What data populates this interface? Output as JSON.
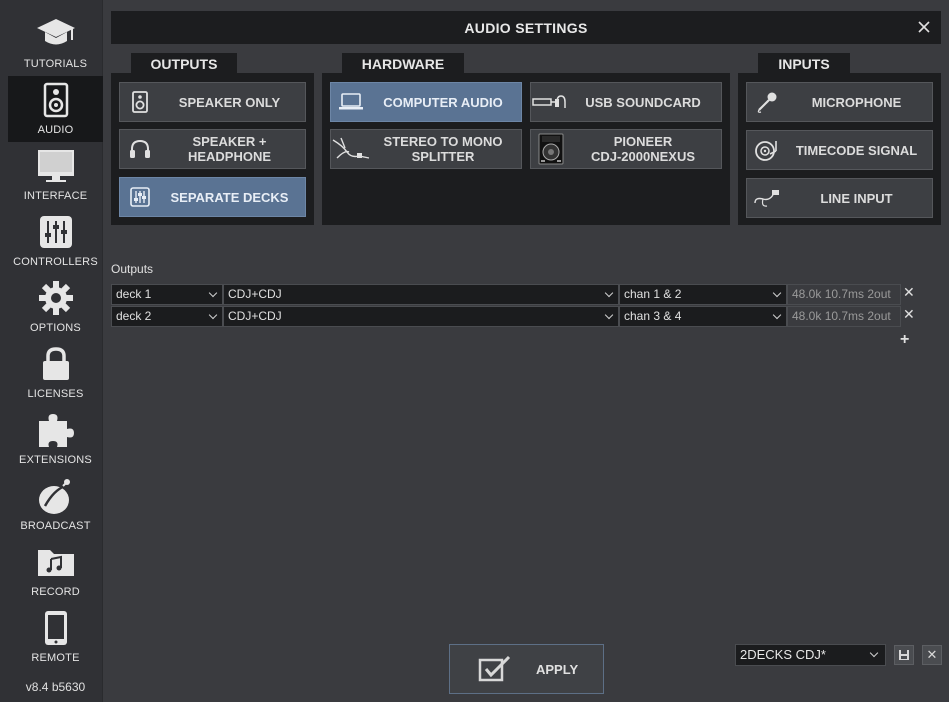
{
  "sidebar": {
    "items": [
      {
        "label": "TUTORIALS",
        "icon": "graduation-cap-icon"
      },
      {
        "label": "AUDIO",
        "icon": "speaker-icon",
        "active": true
      },
      {
        "label": "INTERFACE",
        "icon": "monitor-icon"
      },
      {
        "label": "CONTROLLERS",
        "icon": "sliders-icon"
      },
      {
        "label": "OPTIONS",
        "icon": "gear-icon"
      },
      {
        "label": "LICENSES",
        "icon": "lock-icon"
      },
      {
        "label": "EXTENSIONS",
        "icon": "puzzle-icon"
      },
      {
        "label": "BROADCAST",
        "icon": "satellite-dish-icon"
      },
      {
        "label": "RECORD",
        "icon": "music-folder-icon"
      },
      {
        "label": "REMOTE",
        "icon": "tablet-icon"
      }
    ],
    "version": "v8.4 b5630"
  },
  "titlebar": {
    "title": "AUDIO SETTINGS",
    "close_icon": "close-icon"
  },
  "groups": {
    "outputs": {
      "title": "OUTPUTS",
      "buttons": [
        {
          "label": "SPEAKER ONLY",
          "icon": "speaker-icon",
          "selected": false
        },
        {
          "label": "SPEAKER +\nHEADPHONE",
          "icon": "headphone-icon",
          "selected": false
        },
        {
          "label": "SEPARATE DECKS",
          "icon": "mixer-icon",
          "selected": true
        }
      ]
    },
    "hardware": {
      "title": "HARDWARE",
      "buttons": [
        {
          "label": "COMPUTER AUDIO",
          "icon": "laptop-icon",
          "selected": true
        },
        {
          "label": "USB SOUNDCARD",
          "icon": "usb-cable-icon",
          "selected": false
        },
        {
          "label": "STEREO TO MONO\nSPLITTER",
          "icon": "splitter-cable-icon",
          "selected": false
        },
        {
          "label": "PIONEER\nCDJ-2000NEXUS",
          "icon": "cdj-icon",
          "selected": false
        }
      ]
    },
    "inputs": {
      "title": "INPUTS",
      "buttons": [
        {
          "label": "MICROPHONE",
          "icon": "microphone-icon",
          "selected": false
        },
        {
          "label": "TIMECODE SIGNAL",
          "icon": "turntable-icon",
          "selected": false
        },
        {
          "label": "LINE INPUT",
          "icon": "line-cable-icon",
          "selected": false
        }
      ]
    }
  },
  "outputs_table": {
    "label": "Outputs",
    "rows": [
      {
        "deck": "deck 1",
        "device": "CDJ+CDJ",
        "channel": "chan 1 & 2",
        "info": "48.0k 10.7ms 2out"
      },
      {
        "deck": "deck 2",
        "device": "CDJ+CDJ",
        "channel": "chan 3 & 4",
        "info": "48.0k 10.7ms 2out"
      }
    ],
    "remove_glyph": "✕",
    "add_glyph": "+"
  },
  "footer": {
    "apply_label": "APPLY",
    "preset_value": "2DECKS CDJ*",
    "save_icon": "save-icon",
    "delete_glyph": "✕"
  },
  "colors": {
    "selected": "#5a7393",
    "panel": "#1c1d1f",
    "background": "#3a3b3f"
  }
}
